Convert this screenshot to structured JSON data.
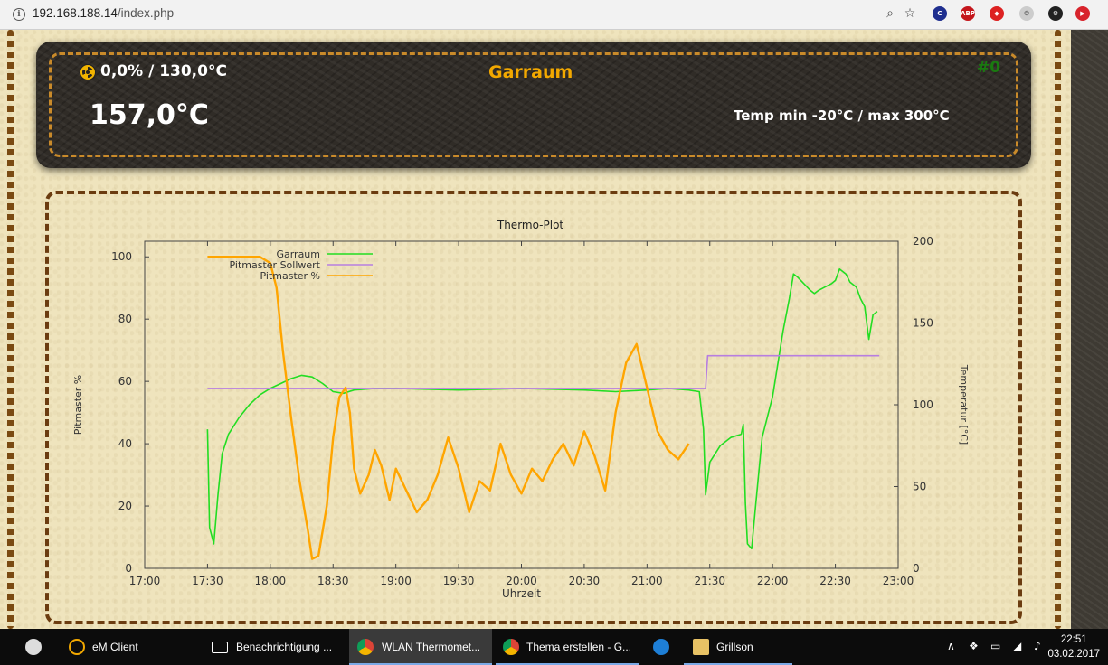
{
  "browser": {
    "url_host": "192.168.188.14",
    "url_path": "/index.php"
  },
  "header": {
    "pit_status": "0,0% / 130,0°C",
    "sensor_name": "Garraum",
    "sensor_number": "#0",
    "temperature": "157,0°C",
    "temp_limits": "Temp min -20°C / max 300°C"
  },
  "chart_data": {
    "type": "line",
    "title": "Thermo-Plot",
    "xlabel": "Uhrzeit",
    "ylabel_left": "Pitmaster %",
    "ylabel_right": "Temperatur [°C]",
    "x_ticks": [
      "17:00",
      "17:30",
      "18:00",
      "18:30",
      "19:00",
      "19:30",
      "20:00",
      "20:30",
      "21:00",
      "21:30",
      "22:00",
      "22:30",
      "23:00"
    ],
    "y_left_ticks": [
      0,
      20,
      40,
      60,
      80,
      100
    ],
    "y_right_ticks": [
      0,
      50,
      100,
      150,
      200
    ],
    "ylim_left": [
      0,
      105
    ],
    "ylim_right": [
      0,
      200
    ],
    "xlim": [
      "17:00",
      "23:00"
    ],
    "legend_position": "top-left",
    "colors": {
      "garraum": "#22dd22",
      "sollwert": "#b77ee0",
      "pitmaster": "#ffa500"
    },
    "series": [
      {
        "name": "Garraum",
        "axis": "right",
        "x": [
          "17:30",
          "17:31",
          "17:33",
          "17:35",
          "17:37",
          "17:40",
          "17:45",
          "17:50",
          "17:55",
          "18:00",
          "18:05",
          "18:10",
          "18:15",
          "18:20",
          "18:25",
          "18:30",
          "18:35",
          "18:40",
          "18:50",
          "19:00",
          "19:30",
          "20:00",
          "20:30",
          "20:45",
          "21:00",
          "21:10",
          "21:20",
          "21:25",
          "21:27",
          "21:28",
          "21:30",
          "21:35",
          "21:40",
          "21:45",
          "21:46",
          "21:47",
          "21:48",
          "21:50",
          "21:52",
          "21:55",
          "22:00",
          "22:05",
          "22:08",
          "22:10",
          "22:12",
          "22:15",
          "22:18",
          "22:20",
          "22:22",
          "22:25",
          "22:28",
          "22:30",
          "22:32",
          "22:35",
          "22:37",
          "22:40",
          "22:42",
          "22:44",
          "22:46",
          "22:48",
          "22:50"
        ],
        "y": [
          85,
          25,
          15,
          45,
          70,
          82,
          92,
          100,
          106,
          110,
          113,
          116,
          118,
          117,
          113,
          108,
          107,
          109,
          110,
          110,
          109,
          110,
          109,
          108,
          109,
          110,
          109,
          108,
          85,
          45,
          65,
          75,
          80,
          82,
          88,
          40,
          15,
          12,
          40,
          80,
          105,
          145,
          165,
          180,
          178,
          174,
          170,
          168,
          170,
          172,
          174,
          176,
          183,
          180,
          175,
          172,
          165,
          160,
          140,
          155,
          157
        ]
      },
      {
        "name": "Pitmaster Sollwert",
        "axis": "right",
        "x": [
          "17:30",
          "21:28",
          "21:29",
          "22:51"
        ],
        "y": [
          110,
          110,
          130,
          130
        ]
      },
      {
        "name": "Pitmaster %",
        "axis": "left",
        "x": [
          "17:30",
          "17:33",
          "17:36",
          "17:40",
          "17:45",
          "17:50",
          "17:55",
          "18:00",
          "18:03",
          "18:06",
          "18:10",
          "18:14",
          "18:18",
          "18:20",
          "18:23",
          "18:27",
          "18:30",
          "18:33",
          "18:36",
          "18:38",
          "18:40",
          "18:43",
          "18:47",
          "18:50",
          "18:53",
          "18:57",
          "19:00",
          "19:05",
          "19:10",
          "19:15",
          "19:20",
          "19:25",
          "19:30",
          "19:35",
          "19:40",
          "19:45",
          "19:50",
          "19:55",
          "20:00",
          "20:05",
          "20:10",
          "20:15",
          "20:20",
          "20:25",
          "20:30",
          "20:35",
          "20:40",
          "20:45",
          "20:50",
          "20:55",
          "21:00",
          "21:05",
          "21:10",
          "21:15",
          "21:20"
        ],
        "y": [
          100,
          100,
          100,
          100,
          100,
          100,
          100,
          98,
          90,
          70,
          48,
          28,
          12,
          3,
          4,
          20,
          42,
          55,
          58,
          50,
          32,
          24,
          30,
          38,
          33,
          22,
          32,
          25,
          18,
          22,
          30,
          42,
          32,
          18,
          28,
          25,
          40,
          30,
          24,
          32,
          28,
          35,
          40,
          33,
          44,
          36,
          25,
          50,
          66,
          72,
          58,
          44,
          38,
          35,
          40
        ]
      }
    ]
  },
  "taskbar": {
    "apps": [
      {
        "label": "eM Client"
      },
      {
        "label": "Benachrichtigung ..."
      },
      {
        "label": "WLAN Thermomet..."
      },
      {
        "label": "Thema erstellen - G..."
      },
      {
        "label": ""
      },
      {
        "label": "Grillson"
      }
    ],
    "time": "22:51",
    "date": "03.02.2017"
  }
}
